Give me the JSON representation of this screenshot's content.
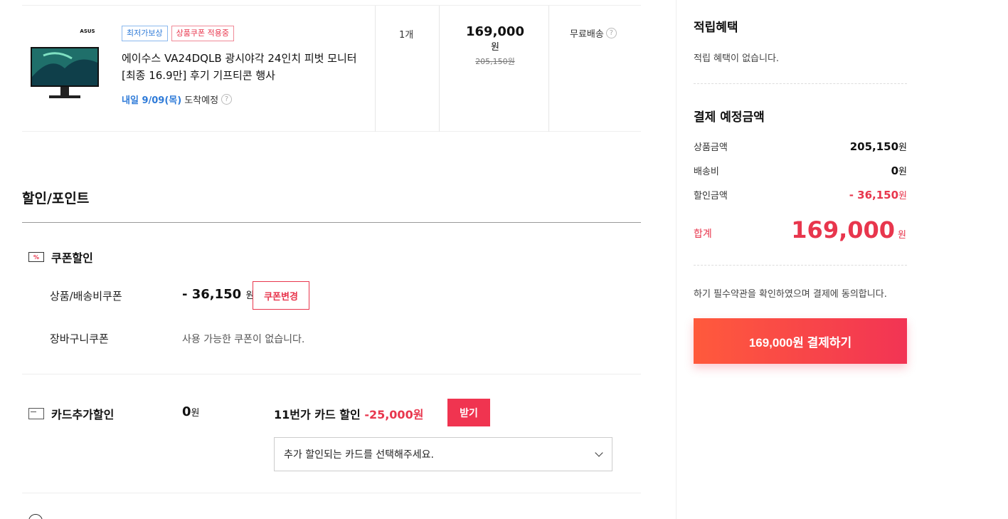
{
  "product": {
    "brand_logo": "ASUS",
    "badges": [
      "최저가보상",
      "상품쿠폰 적용중"
    ],
    "name": "에이수스 VA24DQLB 광시야각 24인치 피벗 모니터 [최종 16.9만] 후기 기프티콘 행사",
    "delivery_date": "내일 9/09(목)",
    "delivery_suffix": "도착예정",
    "quantity": "1개",
    "price": "169,000",
    "price_unit": "원",
    "original_price": "205,150원",
    "shipping": "무료배송"
  },
  "discount": {
    "section_title": "할인/포인트",
    "coupon": {
      "title": "쿠폰할인",
      "product_label": "상품/배송비쿠폰",
      "product_amount": "- 36,150",
      "product_amount_unit": "원",
      "change_button": "쿠폰변경",
      "cart_label": "장바구니쿠폰",
      "cart_none": "사용 가능한 쿠폰이 없습니다."
    },
    "card": {
      "title": "카드추가할인",
      "amount": "0",
      "amount_unit": "원",
      "promo_text": "11번가 카드 할인",
      "promo_discount": "-25,000원",
      "get_button": "받기",
      "select_placeholder": "추가 할인되는 카드를 선택해주세요."
    }
  },
  "summary": {
    "points_title": "적립혜택",
    "points_text": "적립 혜택이 없습니다.",
    "payment_title": "결제 예정금액",
    "rows": [
      {
        "label": "상품금액",
        "value": "205,150",
        "unit": "원"
      },
      {
        "label": "배송비",
        "value": "0",
        "unit": "원"
      },
      {
        "label": "할인금액",
        "value": "- 36,150",
        "unit": "원"
      }
    ],
    "total_label": "합계",
    "total_value": "169,000",
    "total_unit": "원",
    "agree_text": "하기 필수약관을 확인하였으며 결제에 동의합니다.",
    "pay_button": "169,000원 결제하기"
  },
  "colors": {
    "accent": "#f03450",
    "link_blue": "#2f7bd8"
  }
}
